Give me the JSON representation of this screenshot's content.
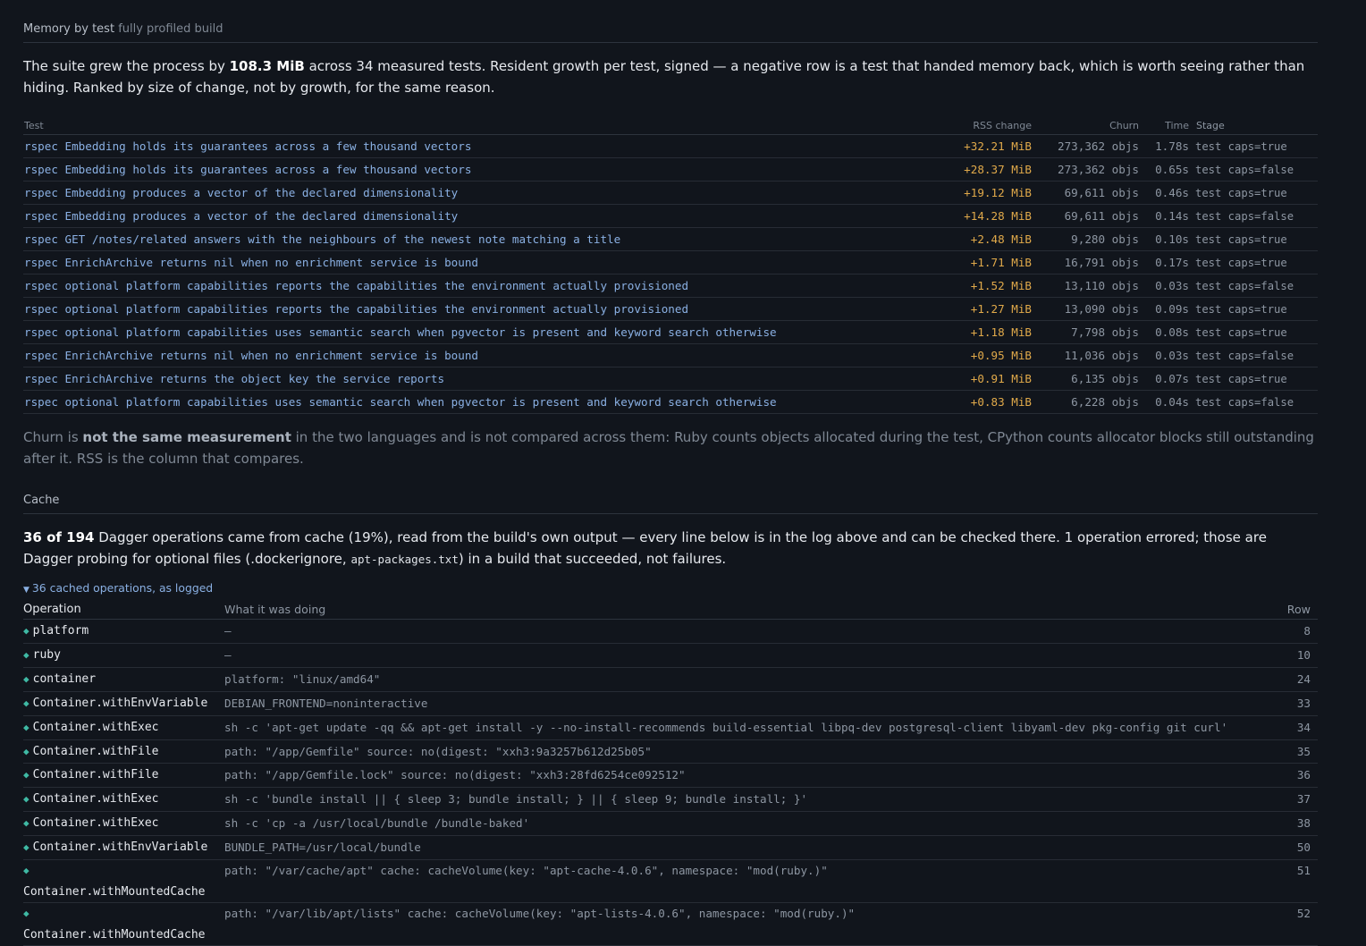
{
  "memory": {
    "heading": "Memory by test",
    "heading_sub": "fully profiled build",
    "lead_pre": "The suite grew the process by ",
    "lead_bold": "108.3 MiB",
    "lead_post": " across 34 measured tests. Resident growth per test, signed — a negative row is a test that handed memory back, which is worth seeing rather than hiding. Ranked by size of change, not by growth, for the same reason.",
    "columns": [
      "Test",
      "RSS change",
      "Churn",
      "Time",
      "Stage"
    ],
    "rows": [
      {
        "test": "rspec Embedding holds its guarantees across a few thousand vectors",
        "rss": "+32.21 MiB",
        "churn": "273,362 objs",
        "time": "1.78s",
        "stage": "test caps=true"
      },
      {
        "test": "rspec Embedding holds its guarantees across a few thousand vectors",
        "rss": "+28.37 MiB",
        "churn": "273,362 objs",
        "time": "0.65s",
        "stage": "test caps=false"
      },
      {
        "test": "rspec Embedding produces a vector of the declared dimensionality",
        "rss": "+19.12 MiB",
        "churn": "69,611 objs",
        "time": "0.46s",
        "stage": "test caps=true"
      },
      {
        "test": "rspec Embedding produces a vector of the declared dimensionality",
        "rss": "+14.28 MiB",
        "churn": "69,611 objs",
        "time": "0.14s",
        "stage": "test caps=false"
      },
      {
        "test": "rspec GET /notes/related answers with the neighbours of the newest note matching a title",
        "rss": "+2.48 MiB",
        "churn": "9,280 objs",
        "time": "0.10s",
        "stage": "test caps=true"
      },
      {
        "test": "rspec EnrichArchive returns nil when no enrichment service is bound",
        "rss": "+1.71 MiB",
        "churn": "16,791 objs",
        "time": "0.17s",
        "stage": "test caps=true"
      },
      {
        "test": "rspec optional platform capabilities reports the capabilities the environment actually provisioned",
        "rss": "+1.52 MiB",
        "churn": "13,110 objs",
        "time": "0.03s",
        "stage": "test caps=false"
      },
      {
        "test": "rspec optional platform capabilities reports the capabilities the environment actually provisioned",
        "rss": "+1.27 MiB",
        "churn": "13,090 objs",
        "time": "0.09s",
        "stage": "test caps=true"
      },
      {
        "test": "rspec optional platform capabilities uses semantic search when pgvector is present and keyword search otherwise",
        "rss": "+1.18 MiB",
        "churn": "7,798 objs",
        "time": "0.08s",
        "stage": "test caps=true"
      },
      {
        "test": "rspec EnrichArchive returns nil when no enrichment service is bound",
        "rss": "+0.95 MiB",
        "churn": "11,036 objs",
        "time": "0.03s",
        "stage": "test caps=false"
      },
      {
        "test": "rspec EnrichArchive returns the object key the service reports",
        "rss": "+0.91 MiB",
        "churn": "6,135 objs",
        "time": "0.07s",
        "stage": "test caps=true"
      },
      {
        "test": "rspec optional platform capabilities uses semantic search when pgvector is present and keyword search otherwise",
        "rss": "+0.83 MiB",
        "churn": "6,228 objs",
        "time": "0.04s",
        "stage": "test caps=false"
      }
    ],
    "note_pre": "Churn is ",
    "note_bold": "not the same measurement",
    "note_post": " in the two languages and is not compared across them: Ruby counts objects allocated during the test, CPython counts allocator blocks still outstanding after it. RSS is the column that compares."
  },
  "cache": {
    "heading": "Cache",
    "lead_bold": "36 of 194",
    "lead_mid": " Dagger operations came from cache (19%), read from the build's own output — every line below is in the log above and can be checked there. 1 operation errored; those are Dagger probing for optional files (.dockerignore, ",
    "lead_code": "apt-packages.txt",
    "lead_post": ") in a build that succeeded, not failures.",
    "toggle_icon": "triangle-down",
    "toggle_label": "36 cached operations, as logged",
    "columns": [
      "Operation",
      "What it was doing",
      "Row"
    ],
    "rows": [
      {
        "op": "platform",
        "what": "—",
        "row": "8"
      },
      {
        "op": "ruby",
        "what": "—",
        "row": "10"
      },
      {
        "op": "container",
        "what": "platform: \"linux/amd64\"",
        "row": "24"
      },
      {
        "op": "Container.withEnvVariable",
        "what": "DEBIAN_FRONTEND=noninteractive",
        "row": "33"
      },
      {
        "op": "Container.withExec",
        "what": "sh -c 'apt-get update -qq && apt-get install -y --no-install-recommends build-essential libpq-dev postgresql-client libyaml-dev pkg-config git curl'",
        "row": "34"
      },
      {
        "op": "Container.withFile",
        "what": "path: \"/app/Gemfile\" source: no(digest: \"xxh3:9a3257b612d25b05\"",
        "row": "35"
      },
      {
        "op": "Container.withFile",
        "what": "path: \"/app/Gemfile.lock\" source: no(digest: \"xxh3:28fd6254ce092512\"",
        "row": "36"
      },
      {
        "op": "Container.withExec",
        "what": "sh -c 'bundle install || { sleep 3; bundle install; } || { sleep 9; bundle install; }'",
        "row": "37"
      },
      {
        "op": "Container.withExec",
        "what": "sh -c 'cp -a /usr/local/bundle /bundle-baked'",
        "row": "38"
      },
      {
        "op": "Container.withEnvVariable",
        "what": "BUNDLE_PATH=/usr/local/bundle",
        "row": "50"
      },
      {
        "op": "Container.withMountedCache",
        "what": "path: \"/var/cache/apt\" cache: cacheVolume(key: \"apt-cache-4.0.6\", namespace: \"mod(ruby.)\"",
        "row": "51"
      },
      {
        "op": "Container.withMountedCache",
        "what": "path: \"/var/lib/apt/lists\" cache: cacheVolume(key: \"apt-lists-4.0.6\", namespace: \"mod(ruby.)\"",
        "row": "52"
      }
    ]
  }
}
